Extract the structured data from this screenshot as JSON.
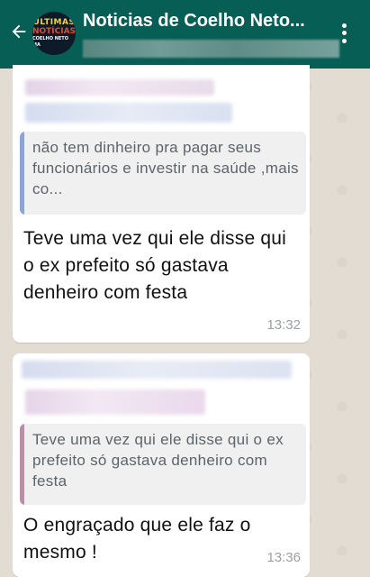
{
  "header": {
    "title": "Noticias de Coelho Neto...",
    "avatar_text": [
      "ÚLTIMAS",
      "NOTÍCIAS",
      "COELHO NETO MA"
    ],
    "icons": {
      "back": "arrow-left-icon",
      "menu": "more-vertical-icon"
    }
  },
  "messages": [
    {
      "quote": {
        "text": "não  tem dinheiro  pra pagar seus funcionários  e investir  na saúde  ,mais co...",
        "bar_color": "#8ea3d6"
      },
      "text": "Teve uma vez qui ele disse qui o ex prefeito só gastava denheiro com festa",
      "time": "13:32"
    },
    {
      "quote": {
        "text": "Teve uma vez qui ele disse qui o ex prefeito só gastava denheiro com festa",
        "bar_color": "#b98fa6"
      },
      "text": "O engraçado  que ele faz o mesmo !",
      "time": "13:36"
    }
  ],
  "colors": {
    "appbar": "#075e54",
    "wallpaper": "#e5ddd5",
    "bubble": "#ffffff",
    "quote_bg": "#f0f0f0"
  }
}
